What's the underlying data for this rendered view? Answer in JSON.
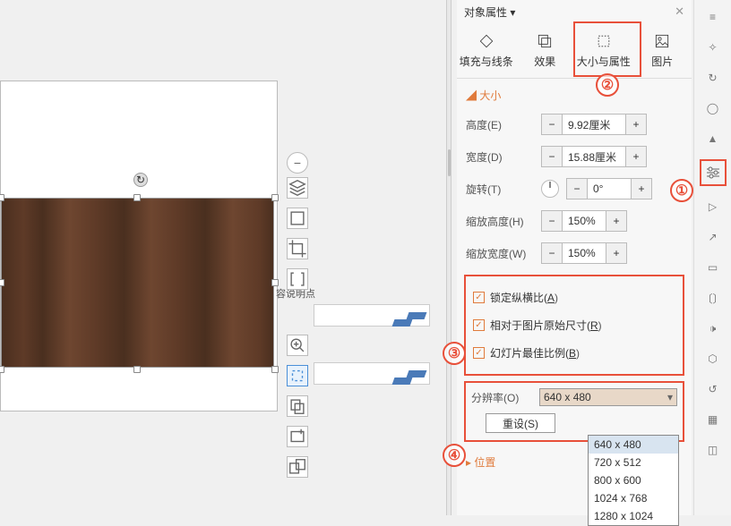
{
  "panel": {
    "title": "对象属性 ▾"
  },
  "tabs": {
    "fill": "填充与线条",
    "effect": "效果",
    "size": "大小与属性",
    "image": "图片"
  },
  "section_size": "大小",
  "rows": {
    "height": {
      "label": "高度(E)",
      "value": "9.92厘米"
    },
    "width": {
      "label": "宽度(D)",
      "value": "15.88厘米"
    },
    "rotate": {
      "label": "旋转(T)",
      "value": "0°"
    },
    "scaleH": {
      "label": "缩放高度(H)",
      "value": "150%"
    },
    "scaleW": {
      "label": "缩放宽度(W)",
      "value": "150%"
    }
  },
  "checks": {
    "lock": "锁定纵横比(",
    "lockK": "A",
    "rel": "相对于图片原始尺寸(",
    "relK": "R",
    "best": "幻灯片最佳比例(",
    "bestK": "B"
  },
  "resolution": {
    "label": "分辨率(O)",
    "value": "640 x 480",
    "options": [
      "640 x 480",
      "720 x 512",
      "800 x 600",
      "1024 x 768",
      "1280 x 1024"
    ]
  },
  "reset": "重设(S)",
  "section_pos": "位置",
  "hotspot": "容说明点",
  "callouts": {
    "c1": "①",
    "c2": "②",
    "c3": "③",
    "c4": "④"
  }
}
